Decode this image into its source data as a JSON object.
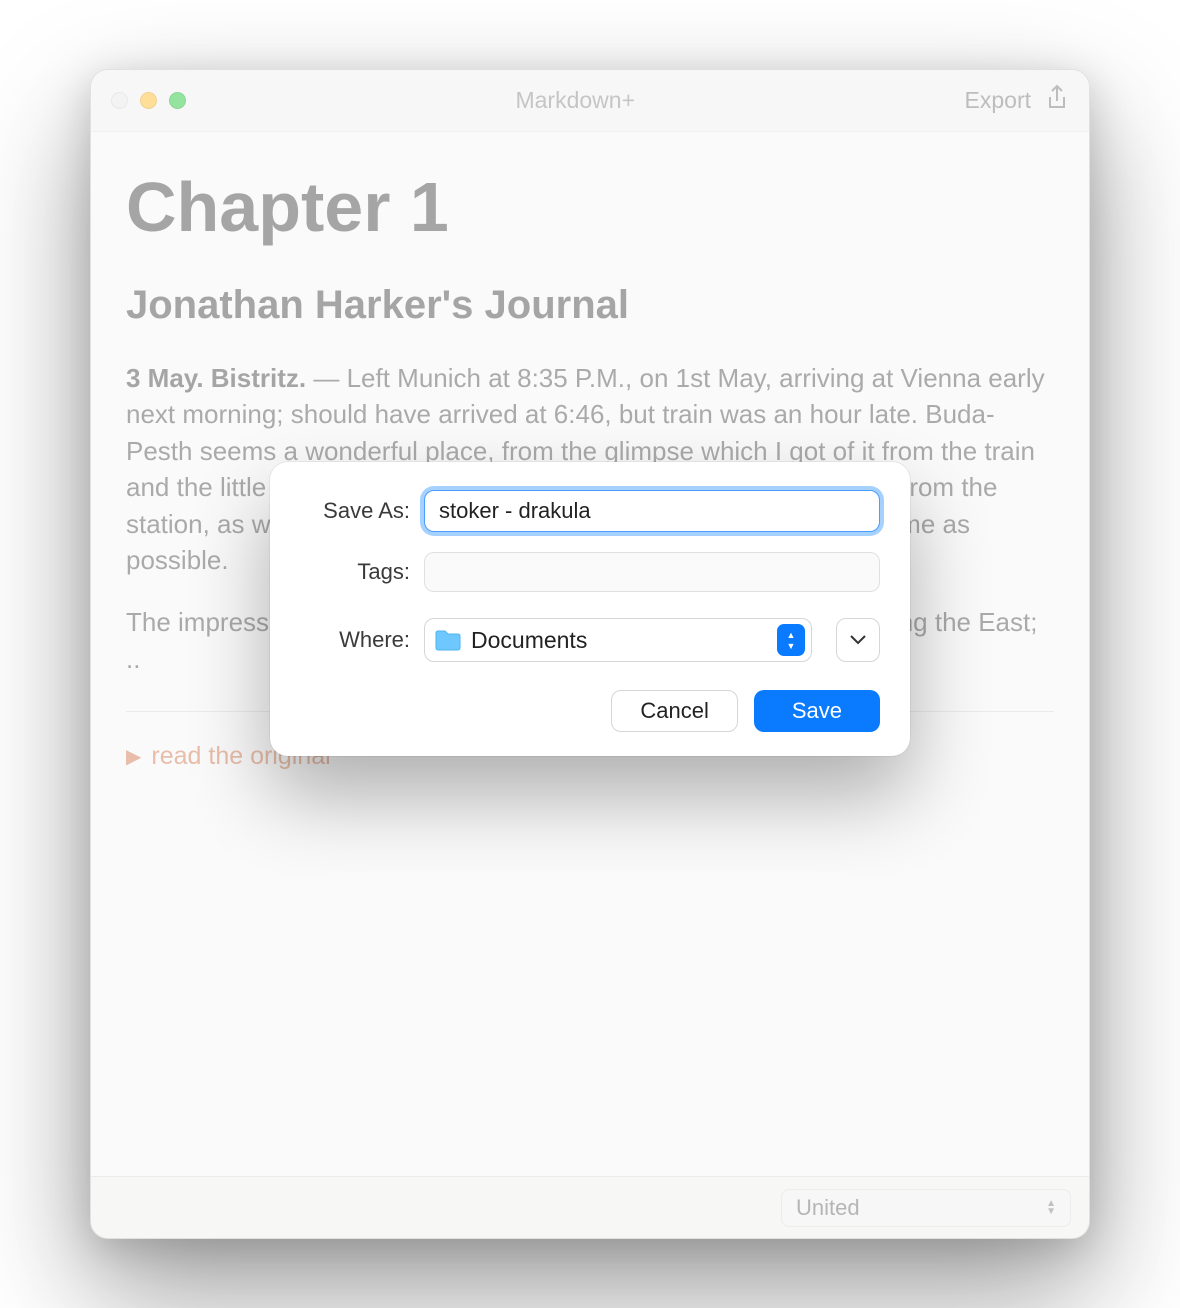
{
  "window": {
    "title": "Markdown+",
    "export_label": "Export"
  },
  "doc": {
    "h1": "Chapter 1",
    "h2": "Jonathan Harker's Journal",
    "date_bold": "3 May. Bistritz.",
    "para1_rest": " — Left Munich at 8:35 P.M., on 1st May, arriving at Vienna early next morning; should have arrived at 6:46, but train was an hour late. Buda-Pesth seems a wonderful place, from the glimpse which I got of it from the train and the little I could walk through the streets. I feared to go very far from the station, as we had arrived late and would start as near the correct time as possible.",
    "para2": "The impression I had was that we were leaving the West and entering the East; ..",
    "read_original": "read the original"
  },
  "footer": {
    "language": "United"
  },
  "dialog": {
    "saveas_label": "Save As:",
    "saveas_value": "stoker - drakula",
    "tags_label": "Tags:",
    "tags_value": "",
    "where_label": "Where:",
    "where_value": "Documents",
    "cancel": "Cancel",
    "save": "Save"
  }
}
